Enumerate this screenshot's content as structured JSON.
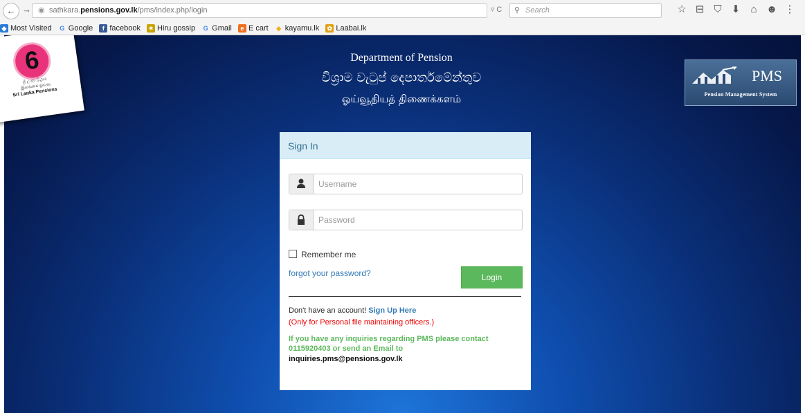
{
  "browser": {
    "url_prefix": "sathkara.",
    "url_domain": "pensions.gov.lk",
    "url_path": "/pms/index.php/login",
    "reload_label": "▿ C",
    "search_placeholder": "Search",
    "bookmarks": [
      {
        "label": "Most Visited",
        "icon": "compass-icon",
        "color": "#2a7ad6"
      },
      {
        "label": "Google",
        "icon": "google-icon",
        "color": "#4285f4"
      },
      {
        "label": "facebook",
        "icon": "facebook-icon",
        "color": "#3b5998"
      },
      {
        "label": "Hiru gossip",
        "icon": "hiru-icon",
        "color": "#c8a300"
      },
      {
        "label": "Gmail",
        "icon": "google-icon",
        "color": "#4285f4"
      },
      {
        "label": "E cart",
        "icon": "ecart-icon",
        "color": "#f07020"
      },
      {
        "label": "kayamu.lk",
        "icon": "kayamu-icon",
        "color": "#f0b020"
      },
      {
        "label": "Laabai.lk",
        "icon": "laabai-icon",
        "color": "#e0a010"
      }
    ]
  },
  "header": {
    "logo_line1": "ශ්‍රී ලංකා විශ්‍රාම",
    "logo_line2": "இலங்கை ஓய்வு",
    "logo_line3": "Sri Lanka Pensions",
    "title_en": "Department of Pension",
    "title_si": "විශ්‍රාම වැටුප් දෙපාර්තමේන්තුව",
    "title_ta": "ஓய்வூதியத் திணைக்களம்",
    "pms_name": "PMS",
    "pms_subtitle": "Pension Management System"
  },
  "login": {
    "heading": "Sign In",
    "username_placeholder": "Username",
    "password_placeholder": "Password",
    "remember_label": "Remember me",
    "forgot_label": "forgot your password?",
    "login_label": "Login",
    "signup_prefix": "Don't have an account!",
    "signup_link": "Sign Up Here",
    "signup_note": "(Only for Personal file maintaining officers.)",
    "inquiry_text": "If you have any inquiries regarding PMS please contact 0115920403 or send an Email to",
    "inquiry_email": "inquiries.pms@pensions.gov.lk"
  },
  "colors": {
    "accent": "#5cb85c",
    "link": "#337ab7",
    "panel_heading_bg": "#d9edf7",
    "page_bg": "#0a2f78",
    "warning": "#ee0000"
  }
}
